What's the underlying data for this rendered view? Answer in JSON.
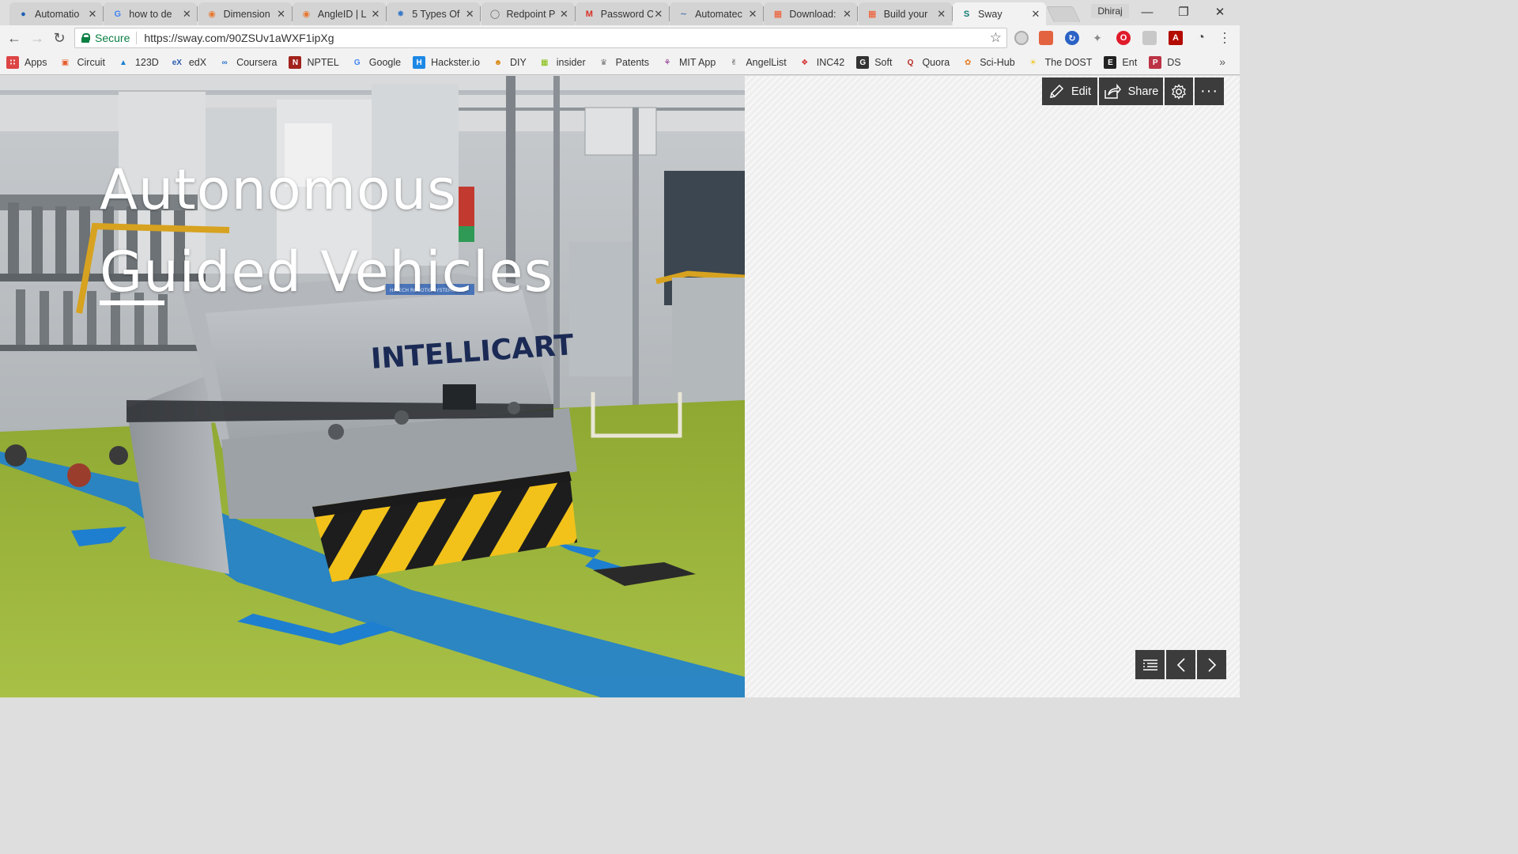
{
  "browser": {
    "tabs": [
      {
        "title": "Automatio",
        "icon": "automation-icon",
        "active": false
      },
      {
        "title": "how to de",
        "icon": "google-icon",
        "active": false
      },
      {
        "title": "Dimension",
        "icon": "orange-circle-icon",
        "active": false
      },
      {
        "title": "AngleID | L",
        "icon": "orange-circle-icon",
        "active": false
      },
      {
        "title": "5 Types Of",
        "icon": "spiral-icon",
        "active": false
      },
      {
        "title": "Redpoint P",
        "icon": "shield-outline-icon",
        "active": false
      },
      {
        "title": "Password C",
        "icon": "gmail-icon",
        "active": false
      },
      {
        "title": "Automatec",
        "icon": "car-icon",
        "active": false
      },
      {
        "title": "Download:",
        "icon": "microsoft-icon",
        "active": false
      },
      {
        "title": "Build your",
        "icon": "microsoft-icon",
        "active": false
      },
      {
        "title": "Sway",
        "icon": "sway-icon",
        "active": true
      }
    ],
    "profile_name": "Dhiraj",
    "secure_label": "Secure",
    "url": "https://sway.com/90ZSUv1aWXF1ipXg"
  },
  "bookmarks": [
    {
      "label": "Apps",
      "icon": "apps-grid-icon"
    },
    {
      "label": "Circuit",
      "icon": "circuit-icon"
    },
    {
      "label": "123D",
      "icon": "autodesk-icon"
    },
    {
      "label": "edX",
      "icon": "edx-icon"
    },
    {
      "label": "Coursera",
      "icon": "coursera-icon"
    },
    {
      "label": "NPTEL",
      "icon": "nptel-icon"
    },
    {
      "label": "Google",
      "icon": "google-icon"
    },
    {
      "label": "Hackster.io",
      "icon": "hackster-icon"
    },
    {
      "label": "DIY",
      "icon": "diy-icon"
    },
    {
      "label": "insider",
      "icon": "microsoft-icon"
    },
    {
      "label": "Patents",
      "icon": "patents-icon"
    },
    {
      "label": "MIT App",
      "icon": "mit-app-icon"
    },
    {
      "label": "AngelList",
      "icon": "angellist-icon"
    },
    {
      "label": "INC42",
      "icon": "inc42-icon"
    },
    {
      "label": "Soft",
      "icon": "soft-icon"
    },
    {
      "label": "Quora",
      "icon": "quora-icon"
    },
    {
      "label": "Sci-Hub",
      "icon": "scihub-icon"
    },
    {
      "label": "The DOST",
      "icon": "bulb-icon"
    },
    {
      "label": "Ent",
      "icon": "ent-icon"
    },
    {
      "label": "DS",
      "icon": "pdf-icon"
    }
  ],
  "sway": {
    "title_line1": "Autonomous",
    "title_line2": "Guided Vehicles",
    "edit_label": "Edit",
    "share_label": "Share",
    "photo_brand_text": "INTELLICART",
    "photo_plate_text": "HI-TECH ROBOTIC SYSTEMS LTD"
  },
  "colors": {
    "accent_secure": "#0b8043",
    "sway_button_bg": "#3c3c3c",
    "floor_green": "#9ab53a",
    "lane_blue": "#1e7fd0"
  }
}
